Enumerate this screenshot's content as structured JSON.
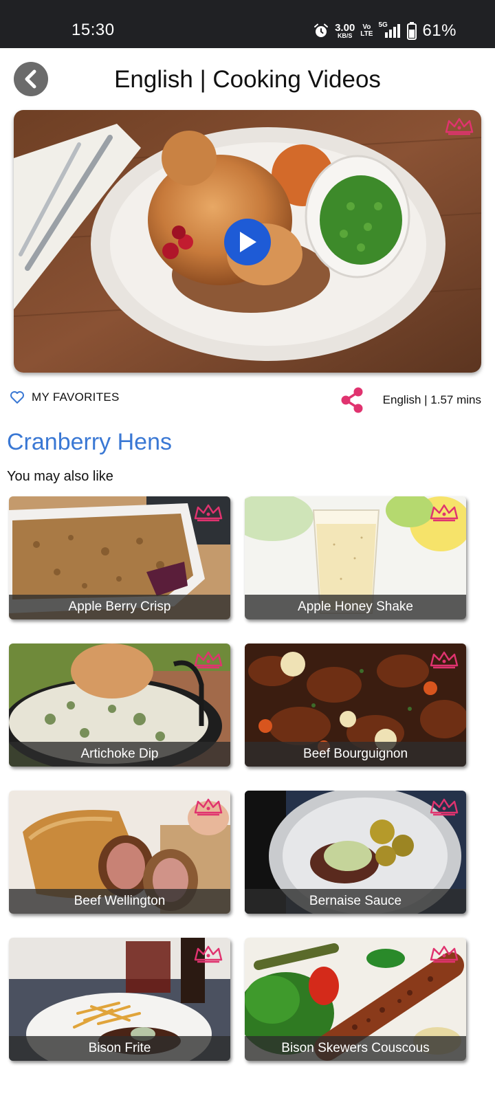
{
  "status_bar": {
    "time": "15:30",
    "speed_value": "3.00",
    "speed_unit": "KB/S",
    "volte_top": "Vo",
    "volte_bottom": "LTE",
    "network": "5G",
    "battery": "61%"
  },
  "header": {
    "title": "English | Cooking Videos"
  },
  "hero": {
    "icon": "play-icon"
  },
  "meta": {
    "favorites_label": "MY FAVORITES",
    "info": "English | 1.57 mins"
  },
  "recipe": {
    "title": "Cranberry Hens",
    "related_label": "You may also like"
  },
  "grid": {
    "items": [
      {
        "label": "Apple Berry Crisp"
      },
      {
        "label": "Apple Honey Shake"
      },
      {
        "label": "Artichoke Dip"
      },
      {
        "label": "Beef Bourguignon"
      },
      {
        "label": "Beef Wellington"
      },
      {
        "label": "Bernaise Sauce"
      },
      {
        "label": "Bison Frite"
      },
      {
        "label": "Bison Skewers Couscous"
      }
    ]
  },
  "colors": {
    "accent_blue": "#3a78d4",
    "premium_pink": "#e0336f",
    "play_blue": "#1e5bd6"
  }
}
